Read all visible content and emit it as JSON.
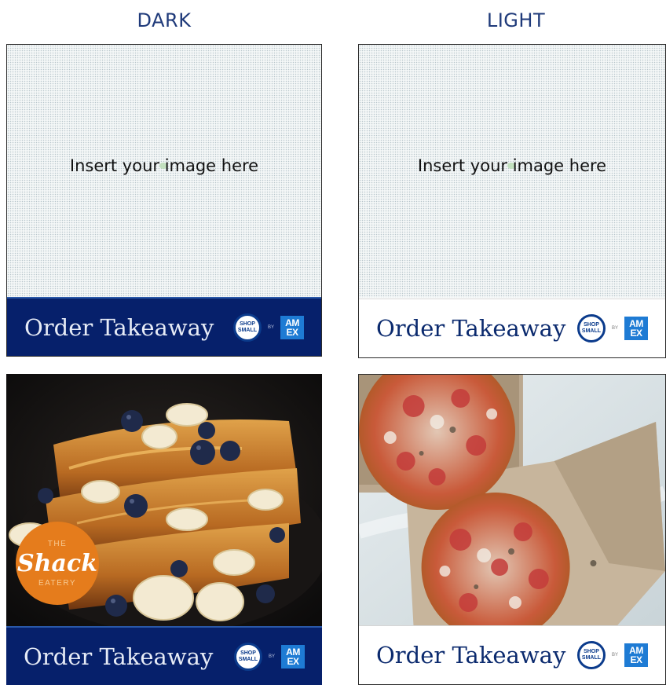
{
  "headers": {
    "dark": "DARK",
    "light": "LIGHT"
  },
  "placeholder_text": "Insert your image here",
  "footer": {
    "order_label": "Order Takeaway",
    "badge_line1": "SHOP",
    "badge_line2": "SMALL",
    "by_label": "BY",
    "amex_line1": "AM",
    "amex_line2": "EX"
  },
  "logo": {
    "the": "THE",
    "shack": "Shack",
    "eatery": "EATERY"
  },
  "colors": {
    "navy": "#06206b",
    "accent_blue": "#1e7bd4",
    "orange": "#e57c1c",
    "header_text": "#1f3a7a"
  },
  "icons": [
    "shop-small-badge-icon",
    "amex-logo-icon",
    "shack-eatery-logo"
  ]
}
